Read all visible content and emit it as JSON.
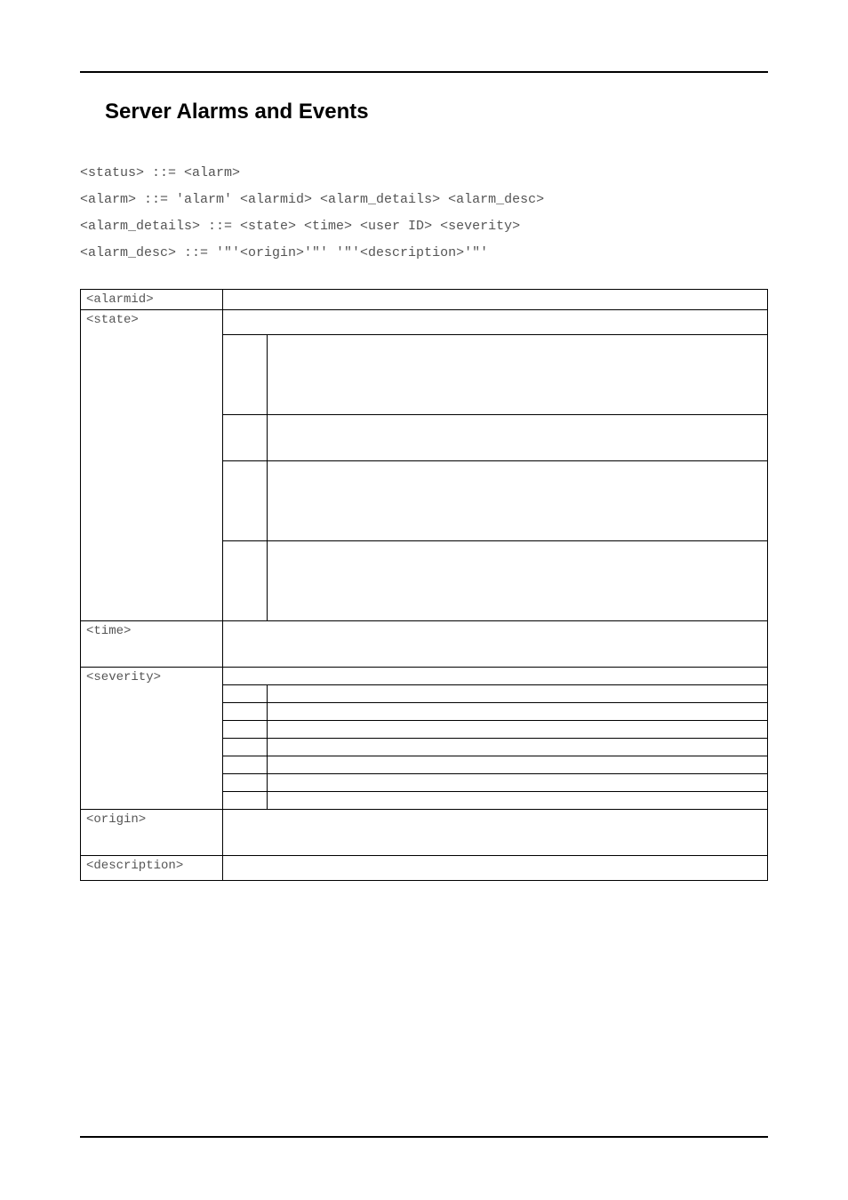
{
  "title": "Server Alarms and Events",
  "bnf": "<status> ::= <alarm>\n<alarm> ::= 'alarm' <alarmid> <alarm_details> <alarm_desc>\n<alarm_details> ::= <state> <time> <user ID> <severity>\n<alarm_desc> ::= '\"'<origin>'\"' '\"'<description>'\"'",
  "rows": {
    "alarmid": "<alarmid>",
    "state": "<state>",
    "time": "<time>",
    "severity": "<severity>",
    "origin": "<origin>",
    "description": "<description>"
  }
}
